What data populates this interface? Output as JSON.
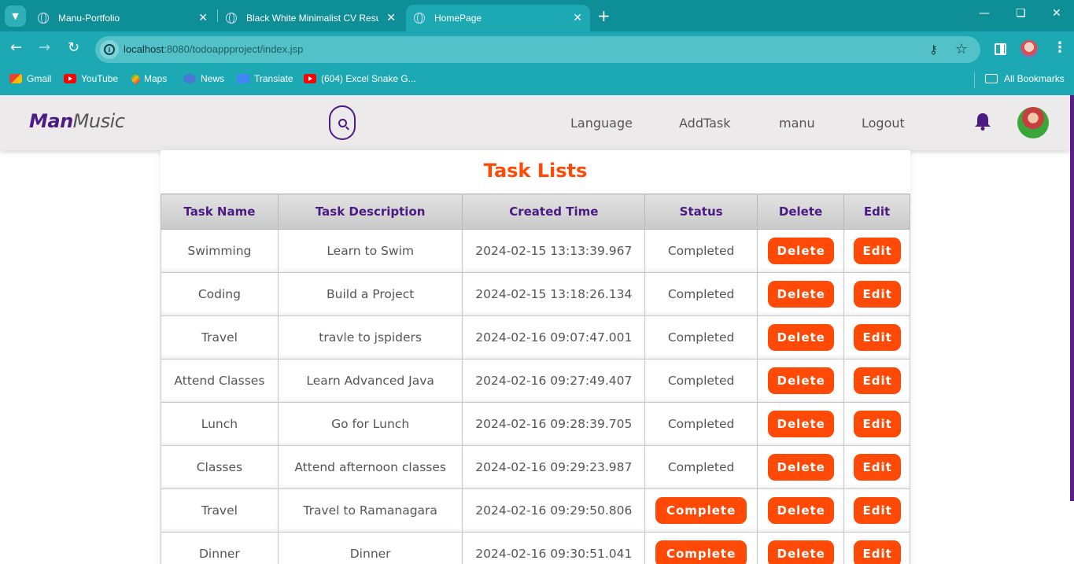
{
  "browser": {
    "tabs": [
      {
        "title": "Manu-Portfolio",
        "active": false
      },
      {
        "title": "Black White Minimalist CV Resu",
        "active": false
      },
      {
        "title": "HomePage",
        "active": true
      }
    ],
    "url_host": "localhost",
    "url_rest": ":8080/todoappproject/index.jsp",
    "bookmarks": [
      "Gmail",
      "YouTube",
      "Maps",
      "News",
      "Translate",
      "(604) Excel Snake G..."
    ],
    "all_bookmarks": "All Bookmarks"
  },
  "navbar": {
    "brand_bold": "Man",
    "brand_light": "Music",
    "links": [
      "Language",
      "AddTask",
      "manu",
      "Logout"
    ]
  },
  "main": {
    "title": "Task Lists",
    "columns": [
      "Task Name",
      "Task Description",
      "Created Time",
      "Status",
      "Delete",
      "Edit"
    ],
    "delete_label": "Delete",
    "edit_label": "Edit",
    "complete_label": "Complete",
    "rows": [
      {
        "name": "Swimming",
        "description": "Learn to Swim",
        "created": "2024-02-15 13:13:39.967",
        "status": "Completed"
      },
      {
        "name": "Coding",
        "description": "Build a Project",
        "created": "2024-02-15 13:18:26.134",
        "status": "Completed"
      },
      {
        "name": "Travel",
        "description": "travle to jspiders",
        "created": "2024-02-16 09:07:47.001",
        "status": "Completed"
      },
      {
        "name": "Attend Classes",
        "description": "Learn Advanced Java",
        "created": "2024-02-16 09:27:49.407",
        "status": "Completed"
      },
      {
        "name": "Lunch",
        "description": "Go for Lunch",
        "created": "2024-02-16 09:28:39.705",
        "status": "Completed"
      },
      {
        "name": "Classes",
        "description": "Attend afternoon classes",
        "created": "2024-02-16 09:29:23.987",
        "status": "Completed"
      },
      {
        "name": "Travel",
        "description": "Travel to Ramanagara",
        "created": "2024-02-16 09:29:50.806",
        "status": ""
      },
      {
        "name": "Dinner",
        "description": "Dinner",
        "created": "2024-02-16 09:30:51.041",
        "status": ""
      }
    ]
  },
  "colors": {
    "accent": "#ff4a07",
    "brand": "#4b1a82",
    "chrome": "#1ca9b3"
  }
}
